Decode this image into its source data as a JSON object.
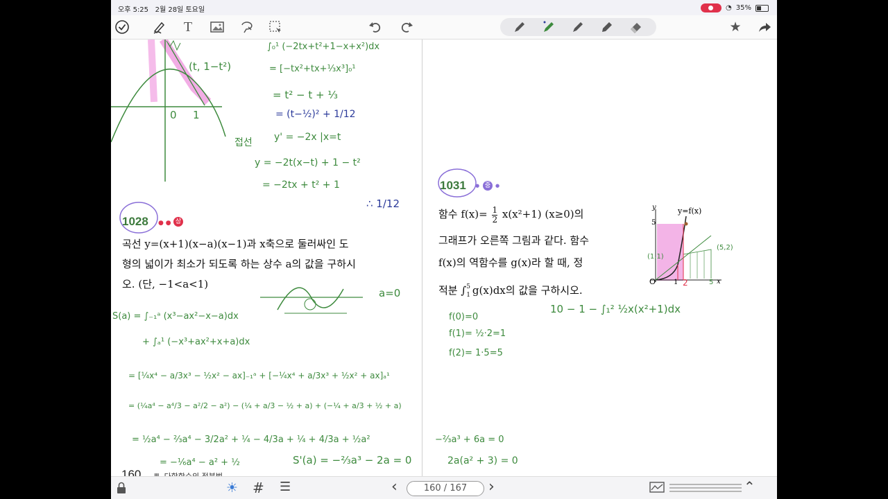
{
  "status_bar": {
    "time": "오후 5:25",
    "date": "2월 28일 토요일",
    "battery": "35%"
  },
  "toolbar": {
    "tools": [
      "check-circle-icon",
      "pen-tool-icon",
      "text-tool-icon",
      "image-tool-icon",
      "lasso-tool-icon",
      "selection-tool-icon",
      "undo-icon",
      "redo-icon"
    ],
    "pens": [
      "pen-icon",
      "pen-active-icon",
      "pen-icon",
      "marker-icon",
      "eraser-icon"
    ],
    "right": [
      "star-icon",
      "share-icon"
    ]
  },
  "page": {
    "page_number": "160",
    "chapter": "Ⅲ. 다항함수의 적분법",
    "problem_1028": {
      "number": "1028",
      "level": "상",
      "line1": "곡선 y=(x+1)(x−a)(x−1)과 x축으로 둘러싸인 도",
      "line2": "형의 넓이가 최소가 되도록 하는 상수 a의 값을 구하시",
      "line3": "오. (단, −1<a<1)"
    },
    "problem_1031": {
      "number": "1031",
      "level": "중",
      "line1a": "함수 f(x)=",
      "frac_num": "1",
      "frac_den": "2",
      "line1b": "x(x²+1) (x≥0)의",
      "line2": "그래프가 오른쪽 그림과 같다. 함수",
      "line3": "f(x)의 역함수를 g(x)라 할 때, 정",
      "line4a": "적분 ∫",
      "int_upper": "5",
      "int_lower": "1",
      "line4b": "g(x)dx의 값을 구하시오.",
      "graph_label": "y=f(x)",
      "graph_y": "y",
      "graph_x": "x",
      "graph_o": "O",
      "graph_5": "5",
      "graph_1": "1",
      "graph_2": "2",
      "graph_5x": "5"
    }
  },
  "handwriting": {
    "top_mid_1": "∫₀¹ (−2tx+t²+1−x+x²)dx",
    "top_mid_2": "= [−tx²+tx+⅓x³]₀¹",
    "top_mid_3": "=  t² − t + ⅓",
    "top_mid_4": "= (t−½)² + 1/12",
    "tangent_label": "접선",
    "tangent_1": "y' = −2x |x=t",
    "tangent_2": "y = −2t(x−t) + 1 − t²",
    "tangent_3": "= −2tx + t² + 1",
    "answer": "∴ 1/12",
    "point": "(t, 1−t²)",
    "g0": "0",
    "g1": "1",
    "a_eq_0": "a=0",
    "s1": "S(a) = ∫₋₁ᵃ (x³−ax²−x−a)dx",
    "s2": "+ ∫ₐ¹ (−x³+ax²+x+a)dx",
    "s3": "= [¼x⁴ − a/3x³ − ½x² − ax]₋₁ᵃ + [−¼x⁴ + a/3x³ + ½x² + ax]ₐ¹",
    "s4": "= (¼a⁴ − a⁴/3 − a²/2 − a²) − (¼ + a/3 − ½ + a) + (−¼ + a/3 + ½ + a)",
    "s5": "= ½a⁴ − ⅔a⁴ − 3/2a² + ¼ − 4/3a + ¼ + 4/3a + ½a²",
    "s6": "= −⅙a⁴ − a² + ½",
    "s_prime": "S'(a) = −⅔a³ − 2a = 0",
    "s7": "−⅔a³ + 6a = 0",
    "s8": "2a(a² + 3) = 0",
    "f0": "f(0)=0",
    "f1": "f(1)= ½·2=1",
    "f2": "f(2)= 1·5=5",
    "area_calc": "10 − 1 − ∫₁² ½x(x²+1)dx",
    "point_52": "(5,2)",
    "point_11": "(1,1)"
  },
  "bottom_bar": {
    "page_indicator": "160 / 167"
  },
  "colors": {
    "green": "#3d8a3d",
    "blue": "#2b3a9a",
    "pink": "#e86ad0",
    "purple": "#8a6fd8",
    "red": "#e0314b"
  }
}
